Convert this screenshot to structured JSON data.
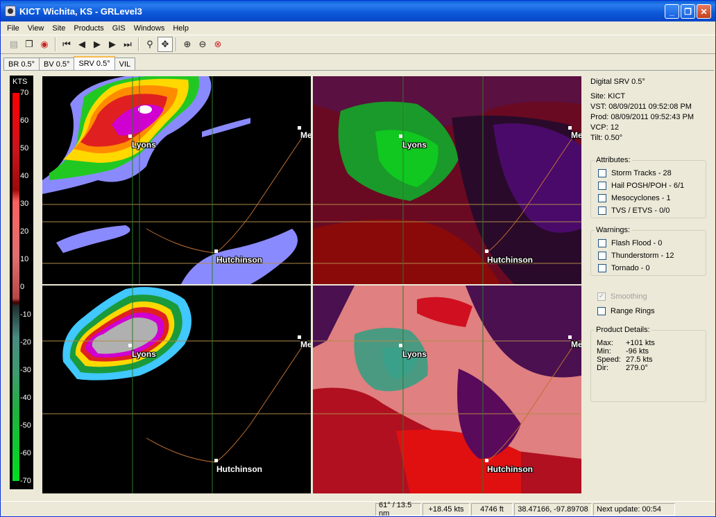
{
  "window": {
    "title": "KICT Wichita, KS - GRLevel3"
  },
  "menu": [
    "File",
    "View",
    "Site",
    "Products",
    "GIS",
    "Windows",
    "Help"
  ],
  "tabs": [
    "BR 0.5°",
    "BV 0.5°",
    "SRV 0.5°",
    "VIL"
  ],
  "active_tab": 2,
  "legend": {
    "unit": "KTS",
    "ticks": [
      "70",
      "60",
      "50",
      "40",
      "30",
      "20",
      "10",
      "0",
      "-10",
      "-20",
      "-30",
      "-40",
      "-50",
      "-60",
      "-70"
    ]
  },
  "cities": {
    "lyons": "Lyons",
    "hutchinson": "Hutchinson",
    "me": "Me"
  },
  "info": {
    "title": "Digital SRV 0.5°",
    "site": "Site:  KICT",
    "vst": "VST:  08/09/2011  09:52:08 PM",
    "prod": "Prod: 08/09/2011  09:52:43 PM",
    "vcp": "VCP:  12",
    "tilt": "Tilt:   0.50°"
  },
  "attributes": {
    "title": "Attributes:",
    "items": [
      "Storm Tracks - 28",
      "Hail POSH/POH - 6/1",
      "Mesocyclones - 1",
      "TVS / ETVS - 0/0"
    ]
  },
  "warnings": {
    "title": "Warnings:",
    "items": [
      "Flash Flood - 0",
      "Thunderstorm - 12",
      "Tornado - 0"
    ]
  },
  "options": {
    "smoothing": "Smoothing",
    "range_rings": "Range Rings"
  },
  "product_details": {
    "title": "Product Details:",
    "max_k": "Max:",
    "max_v": "+101 kts",
    "min_k": "Min:",
    "min_v": "-96 kts",
    "speed_k": "Speed:",
    "speed_v": "27.5 kts",
    "dir_k": "Dir:",
    "dir_v": "279.0°"
  },
  "status": {
    "range": "61° / 13.5 nm",
    "value": "+18.45 kts",
    "height": "4746 ft",
    "coords": "38.47166, -97.89708",
    "next_update": "Next update: 00:54"
  }
}
